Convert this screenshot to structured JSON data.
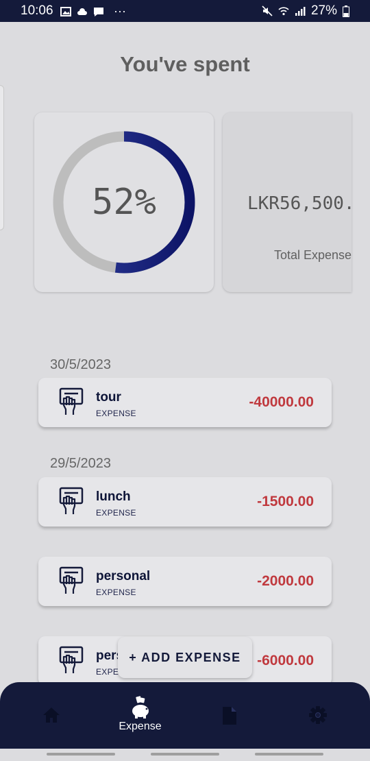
{
  "status_bar": {
    "time": "10:06",
    "battery": "27%",
    "more": "···"
  },
  "header": {
    "title": "You've spent"
  },
  "summary": {
    "percent_label": "52%",
    "percent_value": 0.52,
    "total_amount": "LKR56,500.",
    "total_label": "Total Expense",
    "progress_color": "#1a237e",
    "track_color": "#bdbdbd"
  },
  "groups": [
    {
      "date": "30/5/2023",
      "items": [
        {
          "name": "tour",
          "type": "EXPENSE",
          "amount": "-40000.00",
          "icon": "hand-receipt-icon"
        }
      ]
    },
    {
      "date": "29/5/2023",
      "items": [
        {
          "name": "lunch",
          "type": "EXPENSE",
          "amount": "-1500.00",
          "icon": "hand-receipt-icon"
        },
        {
          "name": "personal",
          "type": "EXPENSE",
          "amount": "-2000.00",
          "icon": "hand-receipt-icon"
        },
        {
          "name": "pers",
          "type": "EXPE",
          "amount": "-6000.00",
          "icon": "hand-receipt-icon"
        }
      ]
    }
  ],
  "add_button": {
    "label": "+ ADD EXPENSE"
  },
  "nav": {
    "items": [
      {
        "name": "home",
        "icon": "home-icon",
        "label": ""
      },
      {
        "name": "expense",
        "icon": "piggy-bank-icon",
        "label": "Expense"
      },
      {
        "name": "reports",
        "icon": "document-icon",
        "label": ""
      },
      {
        "name": "settings",
        "icon": "gear-icon",
        "label": ""
      }
    ]
  },
  "colors": {
    "navy": "#141a3a",
    "amount_red": "#c0393e",
    "background": "#dcdcdf"
  }
}
